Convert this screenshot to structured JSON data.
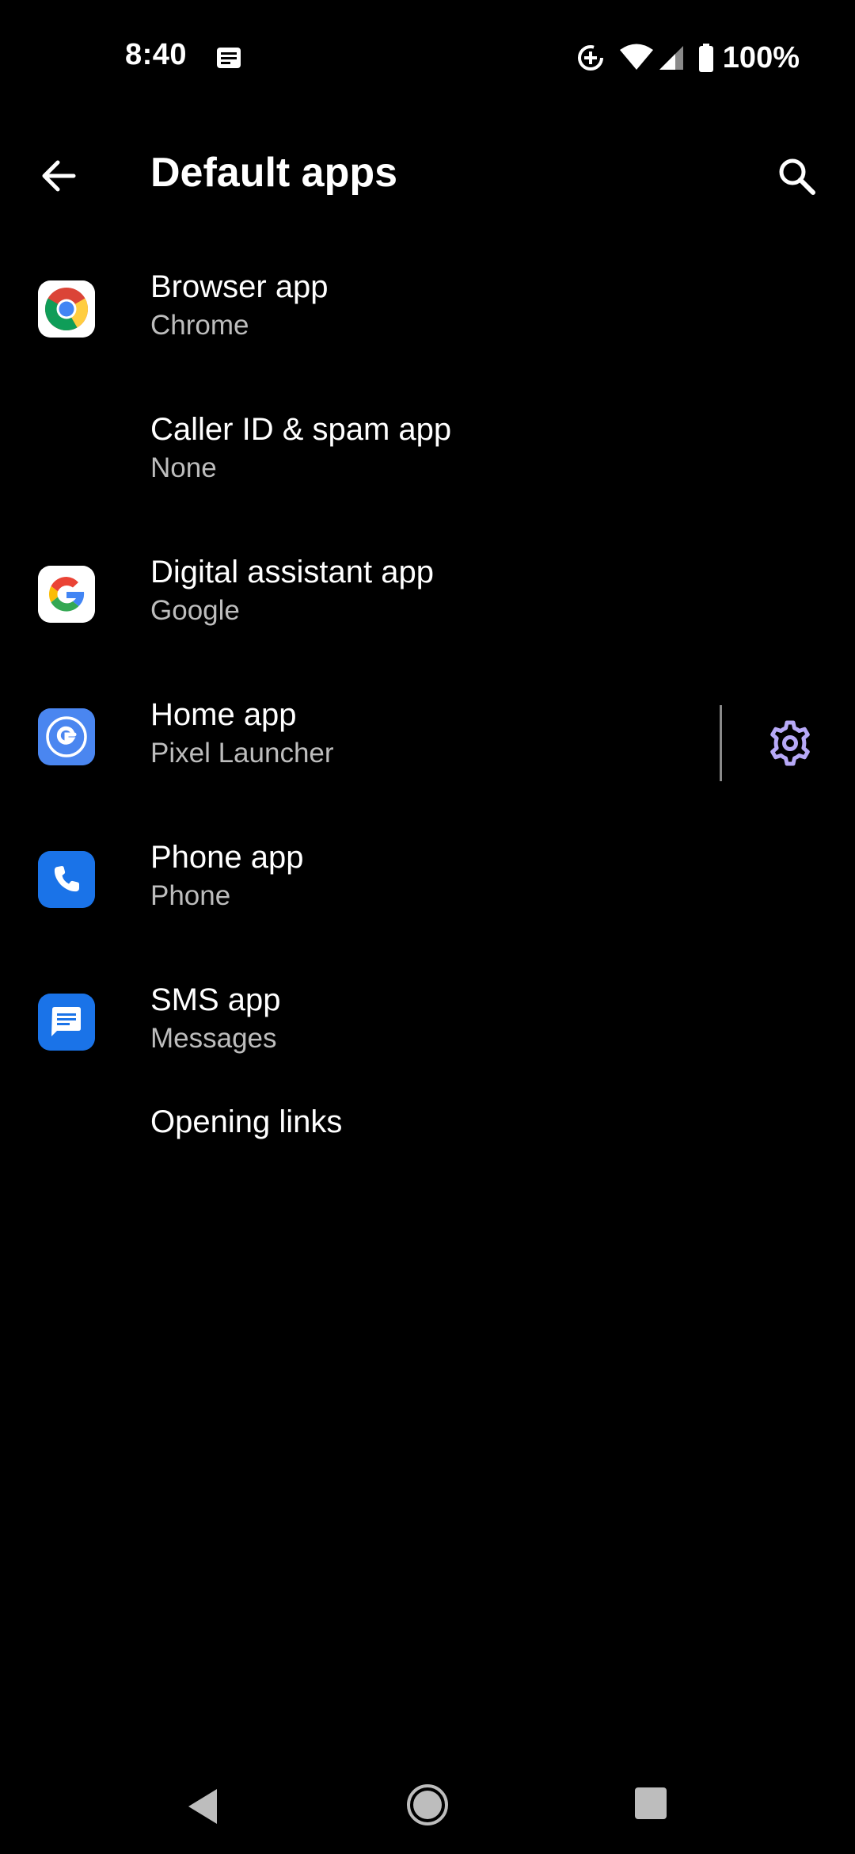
{
  "status_bar": {
    "time": "8:40",
    "battery": "100%",
    "icons": [
      "notification-icon",
      "data-saver-icon",
      "wifi-icon",
      "signal-icon",
      "battery-icon"
    ]
  },
  "app_bar": {
    "title": "Default apps",
    "back_icon": "arrow-back-icon",
    "search_icon": "search-icon"
  },
  "items": [
    {
      "title": "Browser app",
      "summary": "Chrome",
      "icon": "chrome-icon"
    },
    {
      "title": "Caller ID & spam app",
      "summary": "None",
      "icon": ""
    },
    {
      "title": "Digital assistant app",
      "summary": "Google",
      "icon": "google-icon"
    },
    {
      "title": "Home app",
      "summary": "Pixel Launcher",
      "icon": "pixel-launcher-icon",
      "action_icon": "gear-icon"
    },
    {
      "title": "Phone app",
      "summary": "Phone",
      "icon": "phone-icon"
    },
    {
      "title": "SMS app",
      "summary": "Messages",
      "icon": "messages-icon"
    },
    {
      "title": "Opening links",
      "icon": ""
    }
  ],
  "colors": {
    "background": "#000000",
    "summary_text": "#bdbdbd",
    "accent_gear": "#b7a9f7",
    "app_blue": "#1a73e8"
  },
  "nav_bar": {
    "buttons": [
      "nav-back-icon",
      "nav-home-icon",
      "nav-recents-icon"
    ]
  }
}
